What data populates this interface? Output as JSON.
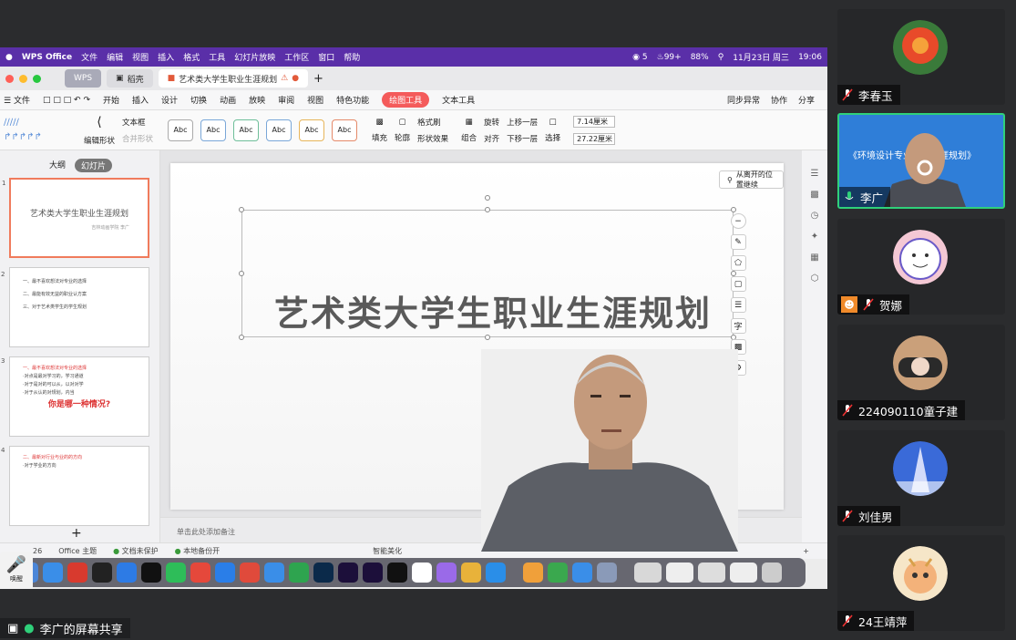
{
  "mac_menu": {
    "app": "WPS Office",
    "items": [
      "文件",
      "编辑",
      "视图",
      "插入",
      "格式",
      "工具",
      "幻灯片放映",
      "工作区",
      "窗口",
      "帮助"
    ],
    "status": {
      "chat_count": "5",
      "notif": "99+",
      "battery": "88%",
      "date": "11月23日 周三",
      "time": "19:06"
    }
  },
  "tabs": [
    {
      "label": "WPS"
    },
    {
      "label": "稻壳"
    },
    {
      "label": "艺术类大学生职业生涯规划"
    }
  ],
  "menubar": {
    "file": "文件",
    "items": [
      "开始",
      "插入",
      "设计",
      "切换",
      "动画",
      "放映",
      "审阅",
      "视图",
      "特色功能"
    ],
    "active": "绘图工具",
    "text_tool": "文本工具",
    "sync": "同步异常",
    "collab": "协作",
    "share": "分享"
  },
  "ribbon": {
    "edit_shape": "编辑形状",
    "text_box": "文本框",
    "merge_shape": "合并形状",
    "style_label": "Abc",
    "fill": "填充",
    "outline": "轮廓",
    "format_painter": "格式刷",
    "shape_effect": "形状效果",
    "group": "组合",
    "rotate": "旋转",
    "align": "对齐",
    "bring_forward": "上移一层",
    "send_backward": "下移一层",
    "select": "选择",
    "width": "7.14厘米",
    "height": "27.22厘米"
  },
  "panel": {
    "tab_outline": "大纲",
    "tab_slides": "幻灯片"
  },
  "thumbs": [
    {
      "num": "1",
      "title": "艺术类大学生职业生涯规划",
      "sub": "吉林动画学院 李广"
    },
    {
      "num": "2",
      "lines": [
        "一、最不喜欢想法对专业的选择",
        "二、最能有效无益的职业认方案",
        "三、对于艺术类学生的学生规划"
      ]
    },
    {
      "num": "3",
      "lines": [
        "一、最不喜欢想法对专业的选择",
        "·对点是最对学习的，学习通道",
        "·对于是对的可以从，以对对学",
        "·对于从认的对规划，内当"
      ],
      "emphasis": "你是哪一种情况?"
    },
    {
      "num": "4",
      "lines": [
        "二、最新对行业与业的的方向",
        "·对于学业的方向"
      ]
    }
  ],
  "slide": {
    "title": "艺术类大学生职业生涯规划",
    "sub_left": "吉林",
    "sub_right": "李广",
    "resume": "从离开的位置继续"
  },
  "notes": "单击此处添加备注",
  "status": {
    "slide_count": "26",
    "theme": "Office 主题",
    "doc_protect": "文档未保护",
    "backup": "本地备份开",
    "smart": "智能美化"
  },
  "mic_badge": "唤醒",
  "participants": [
    {
      "name": "李春玉",
      "muted": true,
      "avatar": "flower"
    },
    {
      "name": "李广",
      "muted": false,
      "speaking": true,
      "banner": "《环境设计专业职业生涯规划》"
    },
    {
      "name": "贺娜",
      "muted": true,
      "avatar": "smile"
    },
    {
      "name": "224090110童子建",
      "muted": true,
      "avatar": "hands"
    },
    {
      "name": "刘佳男",
      "muted": true,
      "avatar": "tower"
    },
    {
      "name": "24王靖萍",
      "muted": true,
      "avatar": "cat"
    }
  ],
  "share_label": "李广的屏幕共享",
  "colors": {
    "mac_bar": "#5a2fa8",
    "accent": "#f45b5b",
    "speaking": "#2fd07a"
  }
}
